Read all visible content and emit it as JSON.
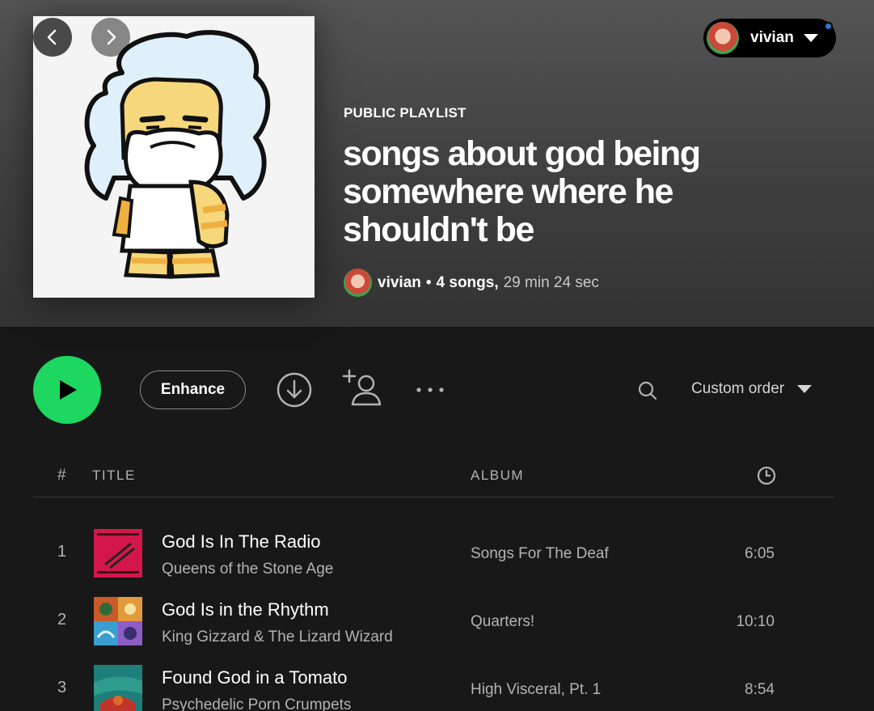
{
  "nav": {
    "back_icon": "chevron-left-icon",
    "forward_icon": "chevron-right-icon"
  },
  "user": {
    "name": "vivian",
    "notification_color": "#2e77d0"
  },
  "playlist": {
    "type_label": "PUBLIC PLAYLIST",
    "title": "songs about god being somewhere where he shouldn't be",
    "owner": "vivian",
    "dot": "•",
    "song_count": "4 songs,",
    "duration": "29 min 24 sec"
  },
  "actions": {
    "enhance_label": "Enhance",
    "sort_label": "Custom order",
    "accent_color": "#1ed760"
  },
  "table": {
    "hash": "#",
    "col_title": "TITLE",
    "col_album": "ALBUM",
    "tracks": [
      {
        "num": "1",
        "title": "God Is In The Radio",
        "artist": "Queens of the Stone Age",
        "album": "Songs For The Deaf",
        "time": "6:05"
      },
      {
        "num": "2",
        "title": "God Is in the Rhythm",
        "artist": "King Gizzard & The Lizard Wizard",
        "album": "Quarters!",
        "time": "10:10"
      },
      {
        "num": "3",
        "title": "Found God in a Tomato",
        "artist": "Psychedelic Porn Crumpets",
        "album": "High Visceral, Pt. 1",
        "time": "8:54"
      }
    ]
  }
}
